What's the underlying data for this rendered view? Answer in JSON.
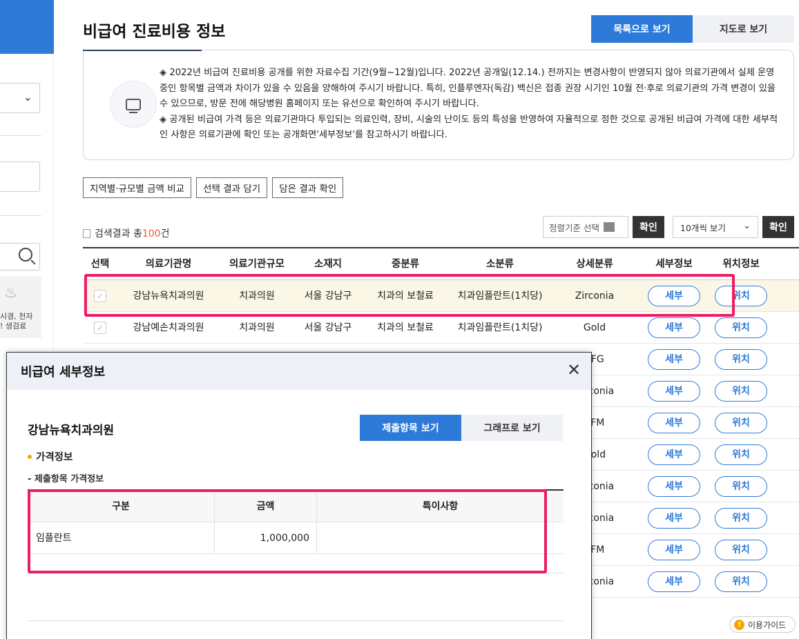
{
  "page": {
    "title": "비급여 진료비용 정보",
    "view_list": "목록으로 보기",
    "view_map": "지도로 보기"
  },
  "left": {
    "card_line1": "시경, 천자",
    "card_line2": "! 생검료"
  },
  "notice": {
    "line1": "◈ 2022년 비급여 진료비용 공개를 위한 자료수집 기간(9월~12월)입니다. 2022년 공개일(12.14.) 전까지는 변경사항이 반영되지 않아 의료기관에서 실제 운영 중인 항목별 금액과 차이가 있을 수 있음을 양해하여 주시기 바랍니다. 특히, 인플루엔자(독감) 백신은 접종 권장 시기인 10월 전·후로 의료기관의 가격 변경이 있을 수 있으므로, 방문 전에 해당병원 홈페이지 또는 유선으로 확인하여 주시기 바랍니다.",
    "line2": "◈ 공개된 비급여 가격 등은 의료기관마다 투입되는 의료인력, 장비, 시술의 난이도 등의 특성을 반영하여 자율적으로 정한 것으로 공개된 비급여 가격에 대한 세부적인 사항은 의료기관에 확인 또는 공개화면'세부정보'를 참고하시기 바랍니다."
  },
  "actions": {
    "compare": "지역별·규모별 금액 비교",
    "save": "선택 결과 담기",
    "view_saved": "담은 결과 확인"
  },
  "results": {
    "prefix": "검색결과 총",
    "count": "100",
    "suffix": "건",
    "sort_label": "정렬기준 선택",
    "confirm": "확인",
    "perpage": "10개씩 보기"
  },
  "table": {
    "headers": [
      "선택",
      "의료기관명",
      "의료기관규모",
      "소재지",
      "중분류",
      "소분류",
      "상세분류",
      "세부정보",
      "위치정보"
    ],
    "rows": [
      {
        "name": "강남뉴욕치과의원",
        "size": "치과의원",
        "loc": "서울 강남구",
        "mid": "치과의 보철료",
        "sub": "치과임플란트(1치당)",
        "detail": "Zirconia"
      },
      {
        "name": "강남예손치과의원",
        "size": "치과의원",
        "loc": "서울 강남구",
        "mid": "치과의 보철료",
        "sub": "치과임플란트(1치당)",
        "detail": "Gold"
      }
    ],
    "detail_col": [
      "PFG",
      "Zirconia",
      "PFM",
      "Gold",
      "Zirconia",
      "Zirconia",
      "PFM",
      "Zirconia"
    ],
    "btn_detail": "세부",
    "btn_location": "위치"
  },
  "guide": "이용가이드",
  "modal": {
    "title": "비급여 세부정보",
    "hospital": "강남뉴욕치과의원",
    "tab_items": "제출항목 보기",
    "tab_graph": "그래프로 보기",
    "section": "가격정보",
    "subsection": "- 제출항목 가격정보",
    "headers": [
      "구분",
      "금액",
      "특이사항"
    ],
    "row": {
      "item": "임플란트",
      "price": "1,000,000",
      "note": ""
    }
  }
}
